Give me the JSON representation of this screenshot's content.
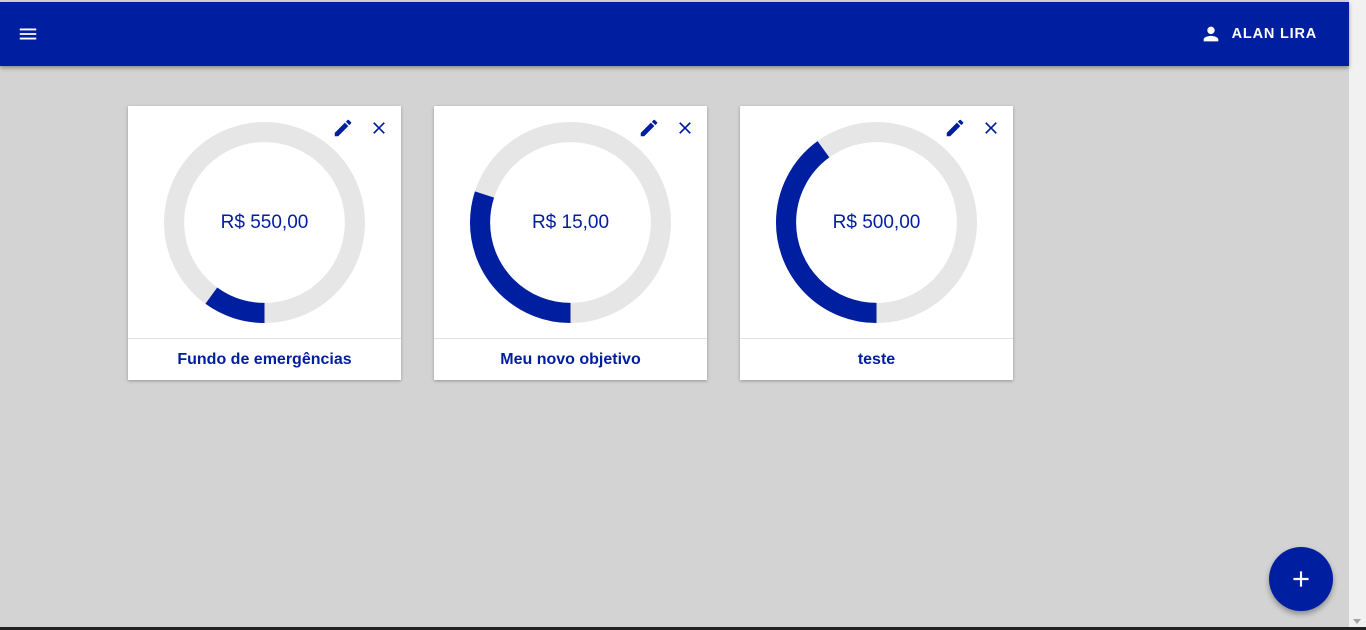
{
  "header": {
    "menu_icon": "hamburger-menu-icon",
    "user_icon": "person-icon",
    "user_name": "ALAN LIRA",
    "background_color": "#001ea0"
  },
  "goals": [
    {
      "amount": "R$ 550,00",
      "name": "Fundo de emergências",
      "progress": 0.1
    },
    {
      "amount": "R$ 15,00",
      "name": "Meu novo objetivo",
      "progress": 0.3
    },
    {
      "amount": "R$ 500,00",
      "name": "teste",
      "progress": 0.4
    }
  ],
  "card_icons": {
    "edit": "pencil-icon",
    "delete": "close-icon"
  },
  "fab": {
    "icon": "plus-icon"
  },
  "colors": {
    "accent": "#001ea0",
    "track": "#e6e6e6",
    "background": "#d3d3d3"
  }
}
